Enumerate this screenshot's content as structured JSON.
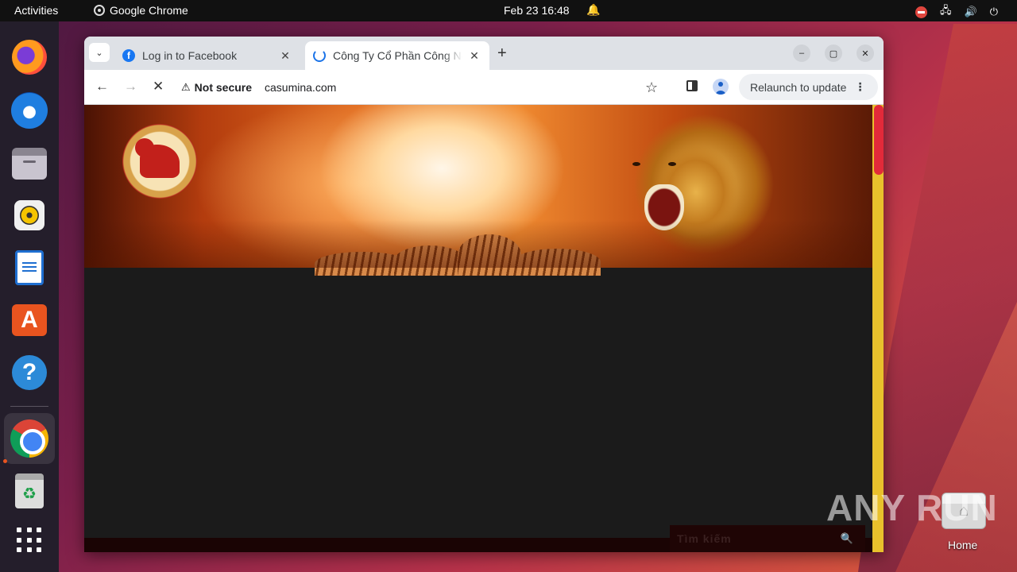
{
  "topbar": {
    "activities": "Activities",
    "app_name": "Google Chrome",
    "clock": "Feb 23  16:48"
  },
  "dock": {
    "items": [
      "firefox-icon",
      "thunderbird-icon",
      "files-icon",
      "rhythmbox-icon",
      "libreoffice-writer-icon",
      "app-center-icon",
      "help-icon",
      "chrome-icon",
      "trash-icon",
      "show-apps-icon"
    ]
  },
  "browser": {
    "tabs": [
      {
        "title": "Log in to Facebook",
        "favicon": "facebook-icon"
      },
      {
        "title": "Công Ty Cổ Phần Công Nghiệp Cao Su Miền Nam",
        "favicon": "loading-icon"
      }
    ],
    "address": {
      "security": "Not secure",
      "url": "casumina.com"
    },
    "relaunch_label": "Relaunch to update"
  },
  "page": {
    "search_placeholder": "Tìm kiếm"
  },
  "desktop": {
    "home_label": "Home",
    "watermark": "ANY RUN"
  },
  "colors": {
    "scrollbar_track": "#e8c12c",
    "scrollbar_thumb": "#e22a3a",
    "page_bg": "#1b1b1b"
  }
}
